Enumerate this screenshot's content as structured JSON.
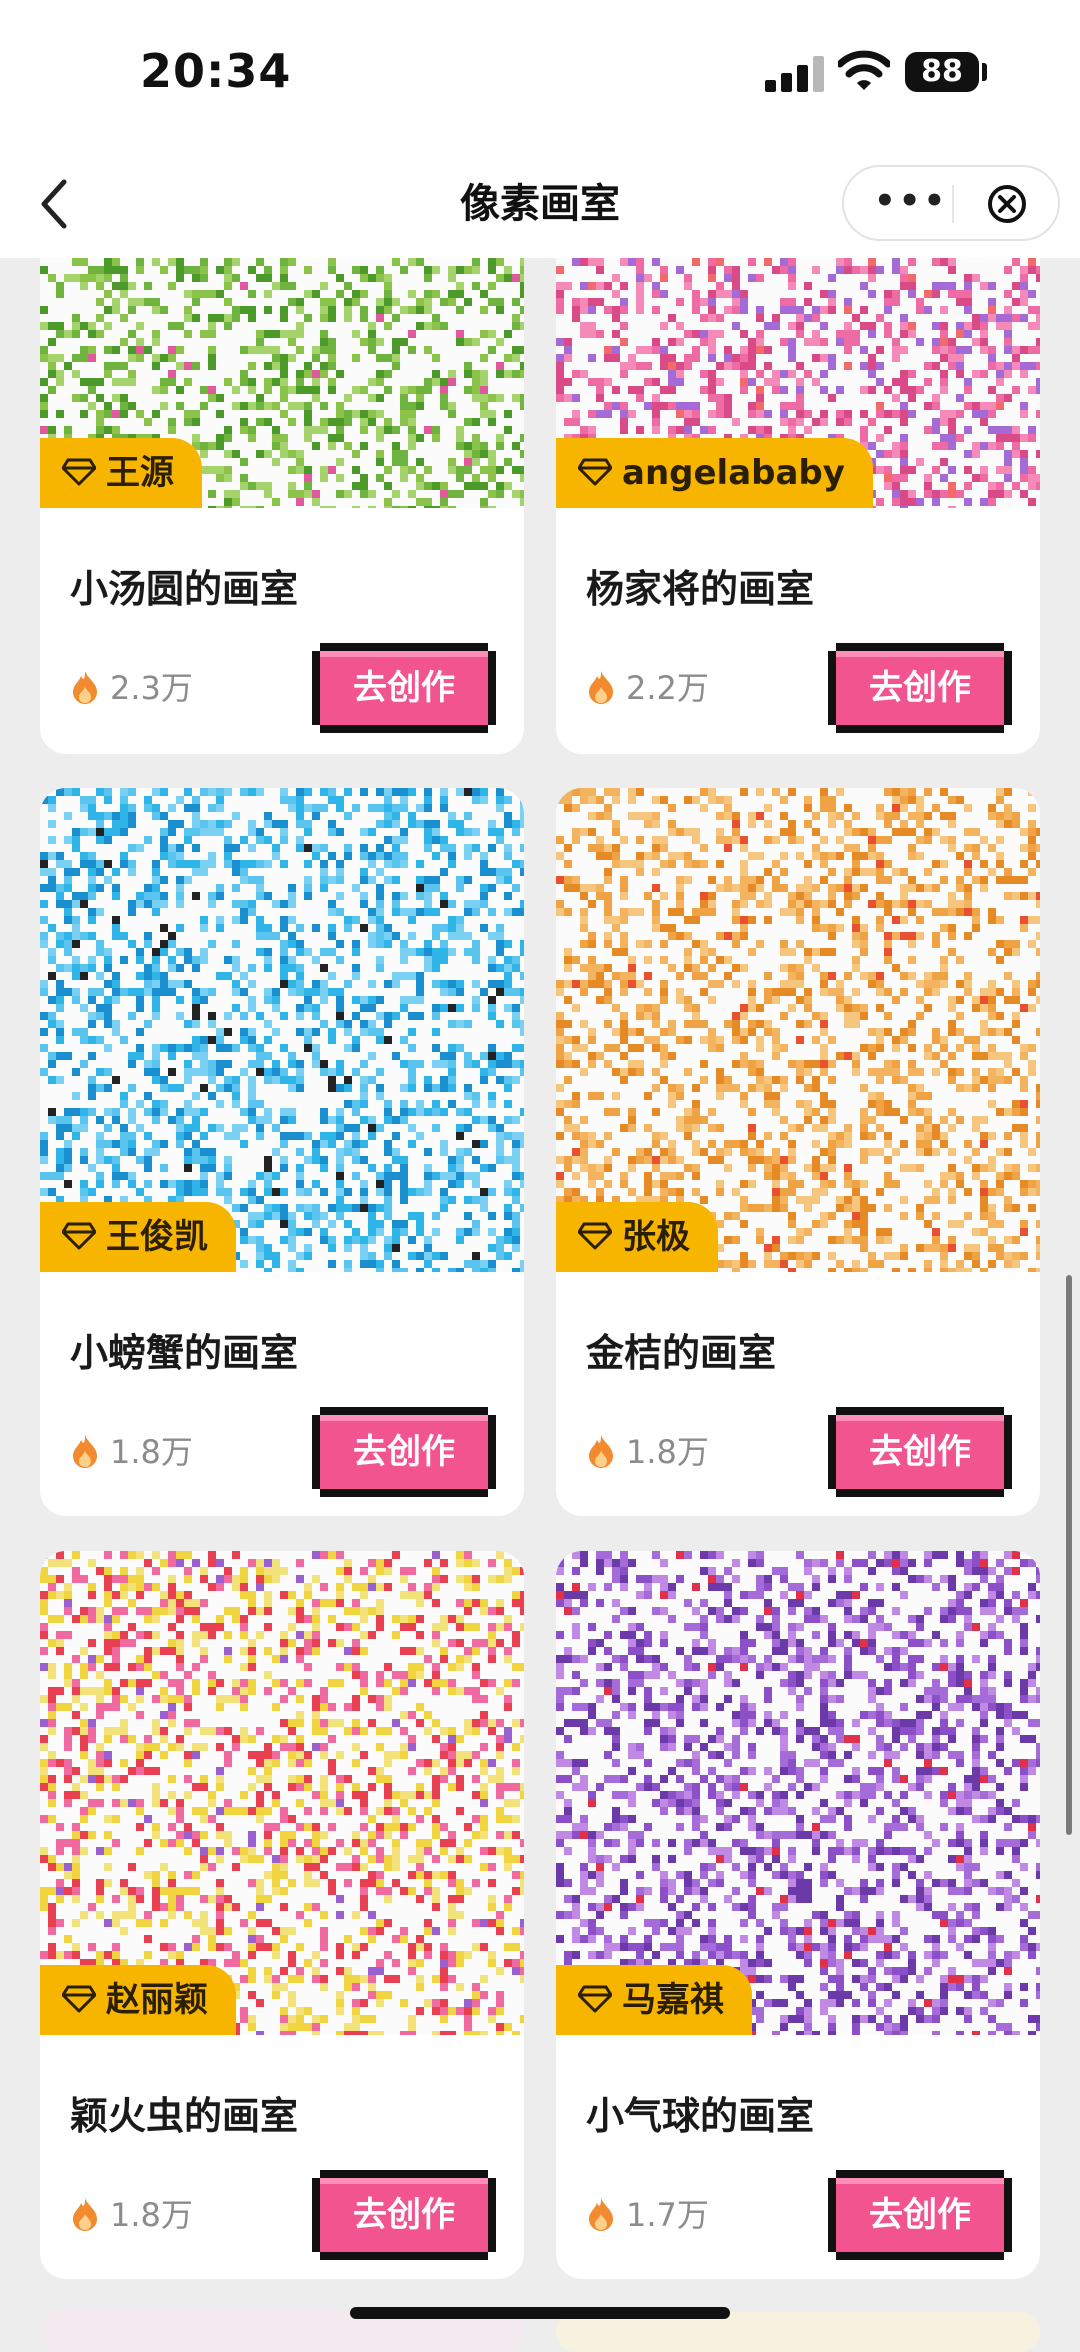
{
  "status": {
    "time": "20:34",
    "battery": "88"
  },
  "nav": {
    "title": "像素画室"
  },
  "cards": [
    {
      "tag": "王源",
      "name": "小汤圆的画室",
      "heat": "2.3万",
      "cta": "去创作",
      "palette": [
        "#6fb43f",
        "#8bc34a",
        "#4c9a2a",
        "#a5d36b",
        "#e05a9b"
      ]
    },
    {
      "tag": "angelababy",
      "name": "杨家将的画室",
      "heat": "2.2万",
      "cta": "去创作",
      "palette": [
        "#ee6ba3",
        "#f58ab8",
        "#d94a86",
        "#a46ad6",
        "#f26a6a"
      ]
    },
    {
      "tag": "王俊凯",
      "name": "小螃蟹的画室",
      "heat": "1.8万",
      "cta": "去创作",
      "palette": [
        "#2fb4e8",
        "#59c4ee",
        "#1a8fd0",
        "#7ad0f2",
        "#222222"
      ]
    },
    {
      "tag": "张极",
      "name": "金桔的画室",
      "heat": "1.8万",
      "cta": "去创作",
      "palette": [
        "#f0a345",
        "#f4b45f",
        "#e68a26",
        "#f7c67e",
        "#e85030"
      ]
    },
    {
      "tag": "赵丽颖",
      "name": "颖火虫的画室",
      "heat": "1.8万",
      "cta": "去创作",
      "palette": [
        "#f0d440",
        "#f06aa0",
        "#e84050",
        "#f3e27a",
        "#9a60d0"
      ]
    },
    {
      "tag": "马嘉祺",
      "name": "小气球的画室",
      "heat": "1.7万",
      "cta": "去创作",
      "palette": [
        "#8b4fc7",
        "#a56bd8",
        "#6c3aa8",
        "#c08ae4",
        "#e0304a"
      ]
    }
  ]
}
